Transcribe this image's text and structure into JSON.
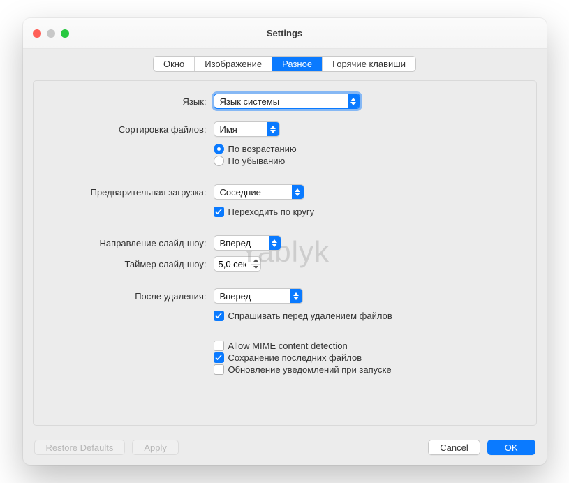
{
  "window": {
    "title": "Settings"
  },
  "tabs": {
    "window_tab": "Окно",
    "image_tab": "Изображение",
    "misc_tab": "Разное",
    "hotkeys_tab": "Горячие клавиши",
    "active": "misc_tab"
  },
  "labels": {
    "language": "Язык:",
    "sort": "Сортировка файлов:",
    "preload": "Предварительная загрузка:",
    "slideshow_dir": "Направление слайд-шоу:",
    "slideshow_timer": "Таймер слайд-шоу:",
    "after_delete": "После удаления:"
  },
  "values": {
    "language": "Язык системы",
    "sort": "Имя",
    "preload": "Соседние",
    "slideshow_dir": "Вперед",
    "slideshow_timer": "5,0 сек",
    "after_delete": "Вперед"
  },
  "radios": {
    "ascending": "По возрастанию",
    "descending": "По убыванию"
  },
  "checks": {
    "loop": "Переходить по кругу",
    "ask_delete": "Спрашивать перед удалением файлов",
    "allow_mime": "Allow MIME content detection",
    "save_recent": "Сохранение последних файлов",
    "update_notify": "Обновление уведомлений при запуске"
  },
  "buttons": {
    "restore": "Restore Defaults",
    "apply": "Apply",
    "cancel": "Cancel",
    "ok": "OK"
  },
  "watermark": "Yablyk"
}
